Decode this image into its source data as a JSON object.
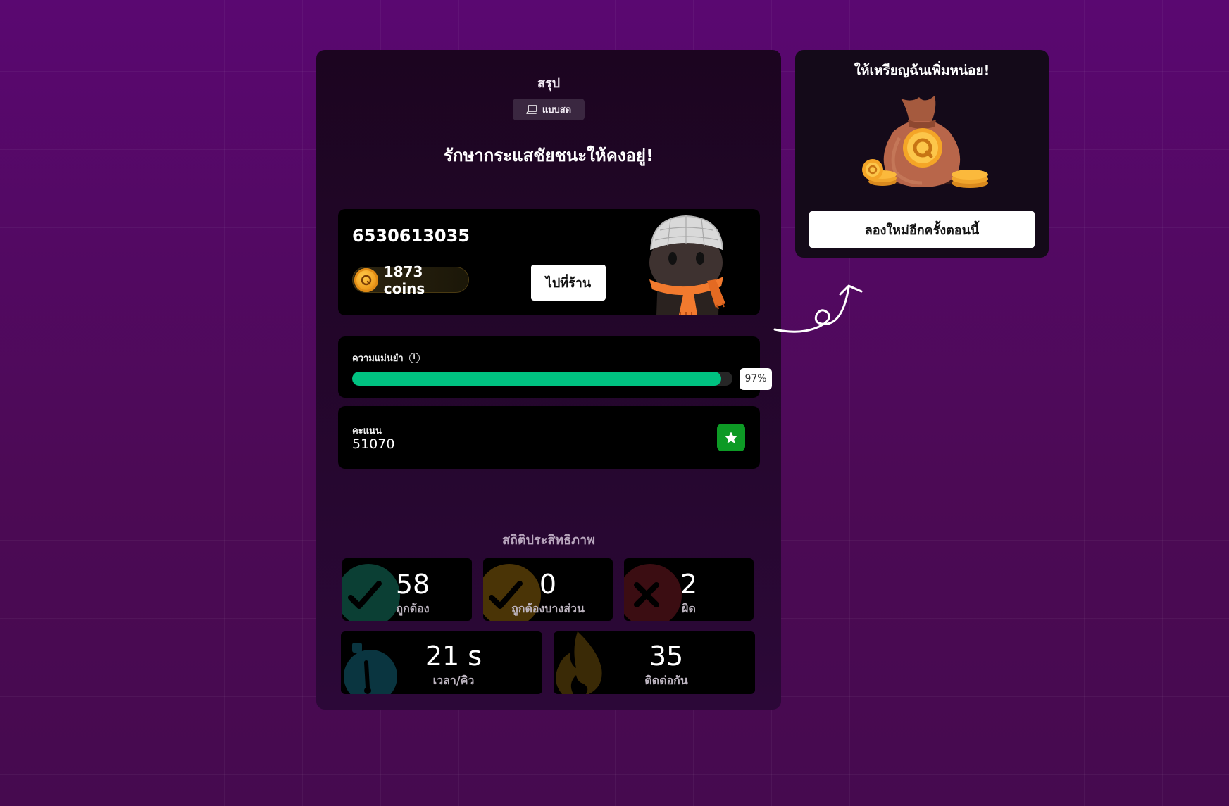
{
  "summary": {
    "title": "สรุป",
    "mode_badge": "แบบสด",
    "heading": "รักษากระแสชัยชนะให้คงอยู่!"
  },
  "user": {
    "id": "6530613035",
    "coins": "1873 coins",
    "shop_button": "ไปที่ร้าน"
  },
  "accuracy": {
    "label": "ความแม่นยำ",
    "percent": 97,
    "percent_text": "97%"
  },
  "score": {
    "label": "คะแนน",
    "value": "51070"
  },
  "stats": {
    "heading": "สถิติประสิทธิภาพ",
    "correct": {
      "value": "58",
      "label": "ถูกต้อง",
      "color": "#0b3f34"
    },
    "partial": {
      "value": "0",
      "label": "ถูกต้องบางส่วน",
      "color": "#4a3406"
    },
    "wrong": {
      "value": "2",
      "label": "ผิด",
      "color": "#3b0d12"
    },
    "time": {
      "value": "21 s",
      "label": "เวลา/คิว",
      "color": "#0a3540"
    },
    "streak": {
      "value": "35",
      "label": "ติดต่อกัน",
      "color": "#3a2a06"
    }
  },
  "promo": {
    "title": "ให้เหรียญฉันเพิ่มหน่อย!",
    "retry_button": "ลองใหม่อีกครั้งตอนนี้"
  },
  "colors": {
    "accent_green": "#00c281",
    "star_green": "#0d9a25",
    "background": "#54095f"
  }
}
